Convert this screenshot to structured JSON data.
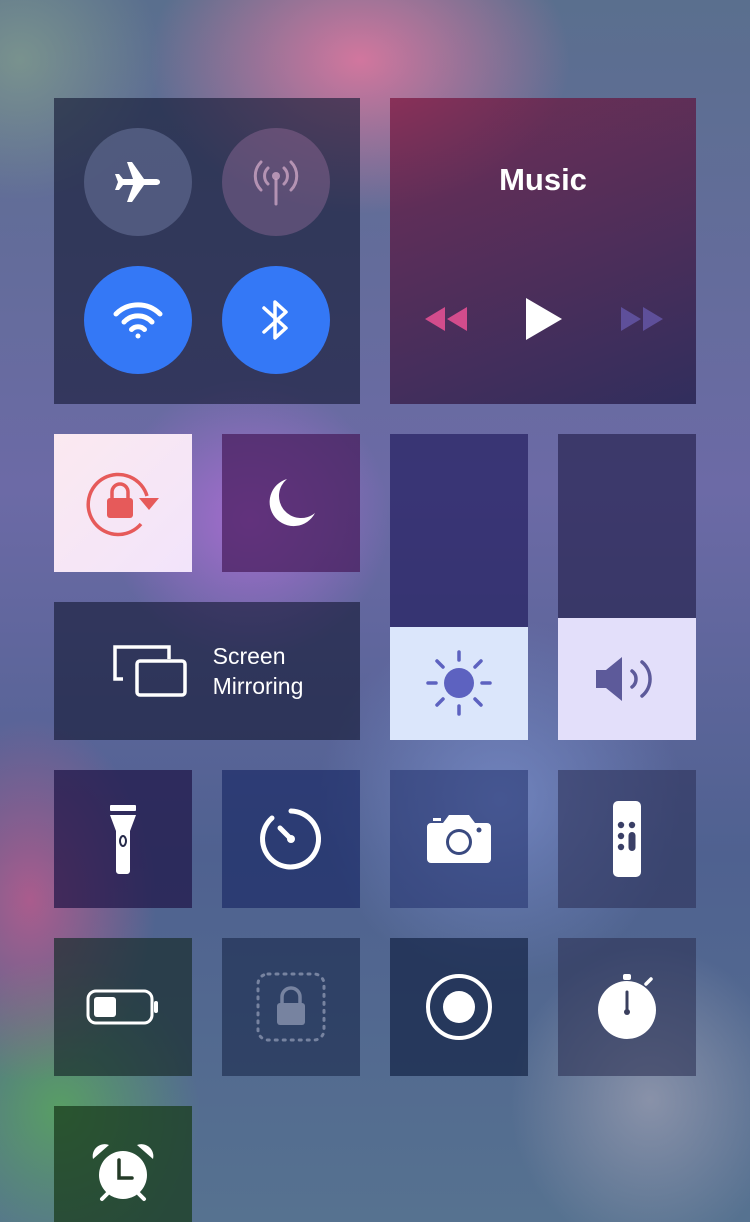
{
  "music": {
    "title": "Music"
  },
  "screen_mirroring": {
    "line1": "Screen",
    "line2": "Mirroring"
  },
  "connectivity": {
    "airplane": {
      "active": false,
      "icon": "airplane-icon"
    },
    "cellular": {
      "active": false,
      "icon": "cellular-antenna-icon"
    },
    "wifi": {
      "active": true,
      "icon": "wifi-icon"
    },
    "bluetooth": {
      "active": true,
      "icon": "bluetooth-icon"
    }
  },
  "sliders": {
    "brightness": {
      "level": 0.37,
      "icon": "sun-icon"
    },
    "volume": {
      "level": 0.4,
      "icon": "speaker-icon"
    }
  },
  "controls": [
    "rotation-lock-icon",
    "moon-icon",
    "flashlight-icon",
    "timer-icon",
    "camera-icon",
    "apple-tv-remote-icon",
    "low-power-battery-icon",
    "guided-access-icon",
    "screen-recording-icon",
    "stopwatch-icon",
    "alarm-icon"
  ],
  "colors": {
    "accent": "#3478f6",
    "rotation_lock": "#e65a5a",
    "tile": "#1c2044"
  }
}
